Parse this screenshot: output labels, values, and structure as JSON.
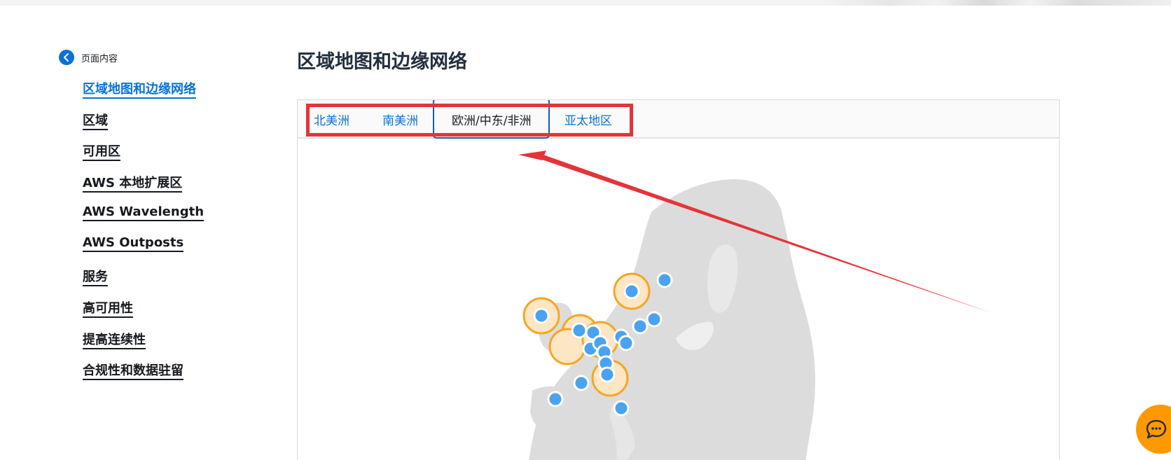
{
  "sidebar": {
    "back_label": "页面内容",
    "items": [
      {
        "label": "区域地图和边缘网络",
        "active": true
      },
      {
        "label": "区域"
      },
      {
        "label": "可用区"
      },
      {
        "label": "AWS 本地扩展区"
      },
      {
        "label": "AWS Wavelength"
      },
      {
        "label": "AWS Outposts"
      },
      {
        "label": "服务"
      },
      {
        "label": "高可用性"
      },
      {
        "label": "提高连续性"
      },
      {
        "label": "合规性和数据驻留"
      }
    ]
  },
  "main": {
    "title": "区域地图和边缘网络",
    "tabs": [
      {
        "label": "北美洲"
      },
      {
        "label": "南美洲"
      },
      {
        "label": "欧洲/中东/非洲",
        "active": true
      },
      {
        "label": "亚太地区"
      }
    ]
  },
  "map": {
    "land_color": "#dcdcdc",
    "edge_point_color": "#4aa3f0",
    "region_ring_color": "#f5a623",
    "region_fill_color": "#fce6c4"
  },
  "colors": {
    "accent": "#0972d3",
    "annotation": "#e4343a",
    "chat": "#ff9900"
  }
}
